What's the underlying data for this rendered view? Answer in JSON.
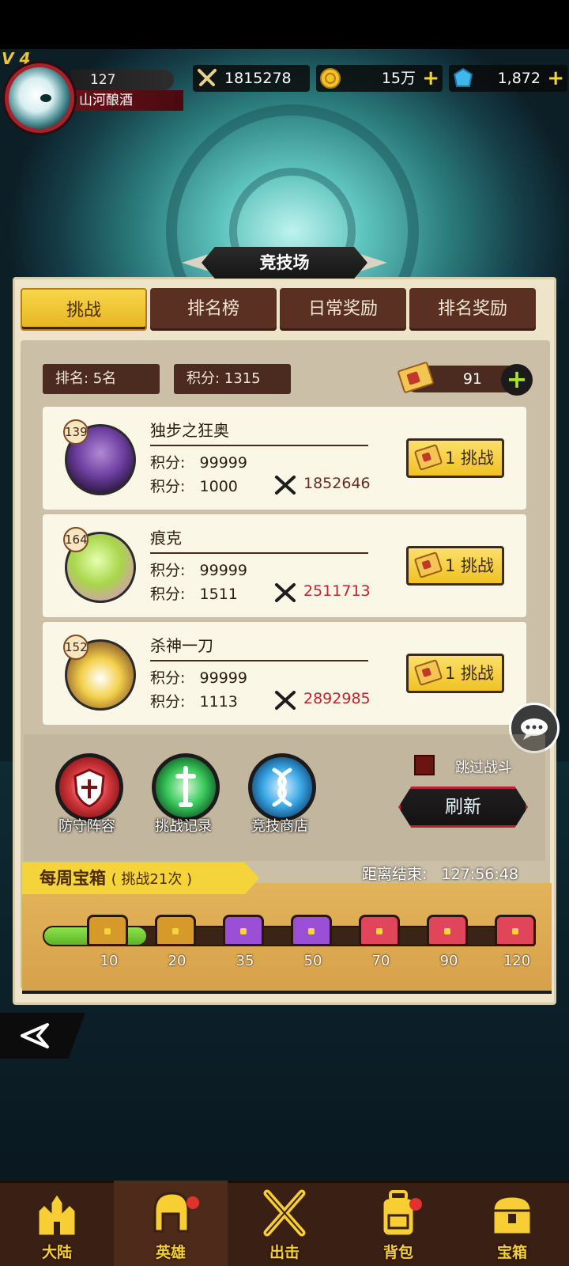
{
  "header": {
    "vip": "V 4",
    "level": "127",
    "player_name": "山河酿酒",
    "power": "1815278",
    "gold": "15万",
    "gems": "1,872",
    "plus": "+"
  },
  "title": "竞技场",
  "tabs": [
    {
      "label": "挑战",
      "active": true
    },
    {
      "label": "排名榜",
      "active": false
    },
    {
      "label": "日常奖励",
      "active": false
    },
    {
      "label": "排名奖励",
      "active": false
    }
  ],
  "summary": {
    "rank": "排名: 5名",
    "score": "积分:  1315",
    "tickets": "91"
  },
  "opponents": [
    {
      "level": "139",
      "name": "独步之狂奥",
      "line1_label": "积分:",
      "line1_value": "99999",
      "line2_label": "积分:",
      "line2_value": "1000",
      "power": "1852646",
      "power_color": "#6b2a2a",
      "button": "1 挑战"
    },
    {
      "level": "164",
      "name": "痕克",
      "line1_label": "积分:",
      "line1_value": "99999",
      "line2_label": "积分:",
      "line2_value": "1511",
      "power": "2511713",
      "power_color": "#c0222c",
      "button": "1 挑战"
    },
    {
      "level": "152",
      "name": "杀神一刀",
      "line1_label": "积分:",
      "line1_value": "99999",
      "line2_label": "积分:",
      "line2_value": "1113",
      "power": "2892985",
      "power_color": "#c0222c",
      "button": "1 挑战"
    }
  ],
  "actions": {
    "defense": "防守阵容",
    "records": "挑战记录",
    "shop": "竞技商店",
    "skip": "跳过战斗",
    "refresh": "刷新"
  },
  "weekly": {
    "title": "每周宝箱",
    "count": "( 挑战21次 )",
    "countdown_label": "距离结束:",
    "countdown": "127:56:48",
    "progress": 0.21,
    "milestones": [
      "10",
      "20",
      "35",
      "50",
      "70",
      "90",
      "120"
    ]
  },
  "nav": [
    {
      "label": "大陆",
      "icon": "castle-icon"
    },
    {
      "label": "英雄",
      "icon": "helmet-icon"
    },
    {
      "label": "出击",
      "icon": "crossed-swords-icon"
    },
    {
      "label": "背包",
      "icon": "backpack-icon"
    },
    {
      "label": "宝箱",
      "icon": "treasure-chest-icon"
    }
  ]
}
